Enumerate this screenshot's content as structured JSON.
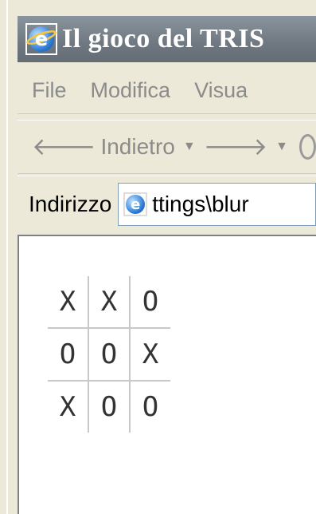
{
  "window": {
    "title": "Il gioco del TRIS"
  },
  "menu": {
    "items": [
      "File",
      "Modifica",
      "Visua"
    ]
  },
  "toolbar": {
    "back_label": "Indietro",
    "back_arrow": "🡐",
    "dropdown_glyph": "▼",
    "forward_arrow": "🡒"
  },
  "address": {
    "label": "Indirizzo",
    "value": "ttings\\blur"
  },
  "board": {
    "rows": [
      [
        "X",
        "X",
        "O"
      ],
      [
        "O",
        "O",
        "X"
      ],
      [
        "X",
        "O",
        "O"
      ]
    ]
  },
  "icons": {
    "title": "ie-page-icon",
    "address": "ie-page-icon"
  },
  "colors": {
    "titlebar": "#6f7880",
    "chrome": "#ece9d8",
    "grid_lines": "#c8c8c8"
  }
}
